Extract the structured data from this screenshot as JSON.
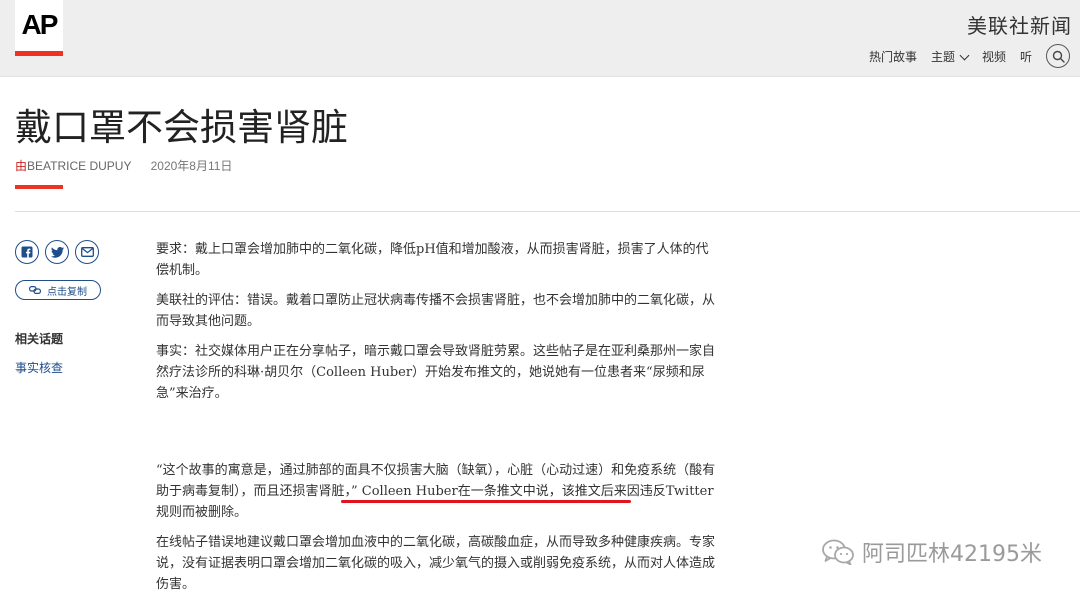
{
  "header": {
    "logo": "AP",
    "site_title": "美联社新闻",
    "nav": {
      "top_stories": "热门故事",
      "topics": "主题",
      "video": "视频",
      "listen": "听"
    }
  },
  "article": {
    "headline": "戴口罩不会损害肾脏",
    "byline_prefix": "由",
    "author": "BEATRICE DUPUY",
    "date": "2020年8月11日",
    "paragraphs": [
      "要求：戴上口罩会增加肺中的二氧化碳，降低pH值和增加酸液，从而损害肾脏，损害了人体的代偿机制。",
      "美联社的评估：错误。戴着口罩防止冠状病毒传播不会损害肾脏，也不会增加肺中的二氧化碳，从而导致其他问题。",
      "事实：社交媒体用户正在分享帖子，暗示戴口罩会导致肾脏劳累。这些帖子是在亚利桑那州一家自然疗法诊所的科琳·胡贝尔（Colleen Huber）开始发布推文的，她说她有一位患者来“尿频和尿急”来治疗。",
      "“这个故事的寓意是，通过肺部的面具不仅损害大脑（缺氧），心脏（心动过速）和免疫系统（酸有助于病毒复制），而且还损害肾脏，” Colleen Huber在一条推文中说，该推文后来因违反Twitter规则而被删除。",
      "在线帖子错误地建议戴口罩会增加血液中的二氧化碳，高碳酸血症，从而导致多种健康疾病。专家说，没有证据表明口罩会增加二氧化碳的吸入，减少氧气的摄入或削弱免疫系统，从而对人体造成伤害。"
    ]
  },
  "sidebar": {
    "copy_link": "点击复制",
    "related_label": "相关话题",
    "related_link": "事实核查"
  },
  "watermark": {
    "text": "阿司匹林42195米"
  },
  "colors": {
    "ap_red": "#ee3322",
    "link_blue": "#1f4e8a",
    "underline_red": "#e0141e"
  },
  "icons": [
    "facebook-icon",
    "twitter-icon",
    "email-icon",
    "link-icon",
    "search-icon",
    "wechat-icon"
  ]
}
